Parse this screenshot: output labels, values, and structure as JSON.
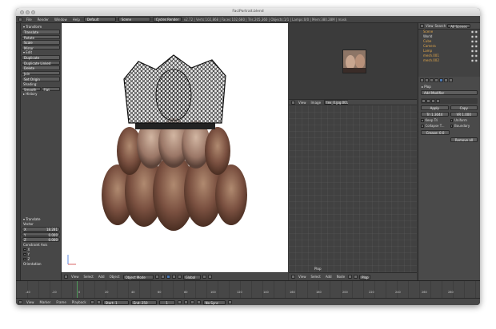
{
  "window": {
    "title": "FaciPortrait.blend"
  },
  "info_bar": {
    "menus": [
      "File",
      "Render",
      "Window",
      "Help"
    ],
    "layout": "Default",
    "scene": "Scene",
    "engine": "Cycles Render",
    "stats": "v2.72 | Verts:102,868 | Faces:102,680 | Tris:205,360 | Objects:1/1 | Lamps:0/0 | Mem:380.28M | mask"
  },
  "tool_shelf": {
    "transform_header": "Transform",
    "transform_buttons": [
      "Translate",
      "Rotate",
      "Scale",
      "Mirror"
    ],
    "edit_header": "Edit",
    "edit_buttons": [
      "Duplicate",
      "Duplicate Linked",
      "Delete",
      "Join"
    ],
    "set_origin": "Set Origin",
    "shading_label": "Shading:",
    "shading_buttons": [
      "Smooth",
      "Flat"
    ],
    "history_header": "History",
    "translate_panel_header": "Translate",
    "vector_label": "Vector",
    "vector": [
      {
        "axis": "X",
        "value": "18.281"
      },
      {
        "axis": "Y",
        "value": "0.000"
      },
      {
        "axis": "Z",
        "value": "0.000"
      }
    ],
    "constraint_label": "Constraint Axis",
    "constraint_axes": [
      "X",
      "Y",
      "Z"
    ],
    "orientation_label": "Orientation"
  },
  "viewport_header": {
    "menus": [
      "View",
      "Select",
      "Add",
      "Object"
    ],
    "mode": "Object Mode",
    "pivot": "Global"
  },
  "uv_editor": {
    "bar_menus": [
      "View",
      "Image"
    ],
    "image_name": "tex_0.jpg.001",
    "label": "Plop",
    "header_menus": [
      "View",
      "Select",
      "Add",
      "Node"
    ],
    "header_right": "Plop"
  },
  "outliner": {
    "tabs": [
      "View",
      "Search",
      "All Scenes"
    ],
    "items": [
      "Scene",
      "World",
      "Cube",
      "Camera",
      "Lamp",
      "mesh.001",
      "mesh.002"
    ]
  },
  "properties": {
    "object_name": "Plop",
    "add_modifier": "Add Modifier",
    "apply": "Apply",
    "copy": "Copy",
    "tri_label": "Tri 1.3044",
    "vert_label": "VR 1.000",
    "options": [
      "Keep Tri",
      "Uniform",
      "Collapse T...",
      "Boundary"
    ],
    "crease": "Crease: 0.0",
    "remove_all": "Remove all"
  },
  "timeline": {
    "menus": [
      "View",
      "Marker",
      "Frame",
      "Playback"
    ],
    "start_label": "Start:",
    "start_value": "1",
    "end_label": "End:",
    "end_value": "250",
    "current_frame": "1",
    "sync": "No Sync",
    "ticks": [
      "-40",
      "-20",
      "0",
      "20",
      "40",
      "60",
      "80",
      "100",
      "120",
      "140",
      "160",
      "180",
      "200",
      "220",
      "240",
      "260",
      "280"
    ]
  },
  "colors": {
    "accent_blue": "#4a78b4",
    "object_orange": "#e0a64a",
    "bg_dark": "#3a3a3a"
  }
}
